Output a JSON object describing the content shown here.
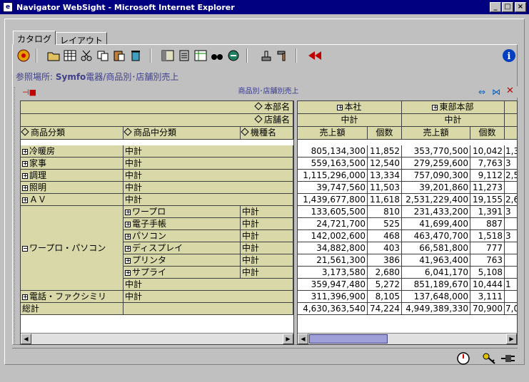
{
  "window": {
    "title": "Navigator WebSight - Microsoft Internet Explorer",
    "min": "_",
    "max": "□",
    "close": "×"
  },
  "tabs": [
    "カタログ",
    "レイアウト"
  ],
  "reference": {
    "label": "参照場所: ",
    "path_bold": "Symfo",
    "path_rest": "電器/商品別･店舗別売上"
  },
  "panel": {
    "title": "商品別･店舗別売上"
  },
  "left_headers": {
    "row1": "本部名",
    "row2": "店舗名",
    "col1": "商品分類",
    "col2": "商品中分類",
    "col3": "機種名"
  },
  "right_headers": {
    "hq1": "本社",
    "hq2": "東部本部",
    "sub1": "中計",
    "sub2": "中計",
    "m1": "売上額",
    "m2": "個数",
    "m3": "売上額",
    "m4": "個数"
  },
  "rows": [
    {
      "c1": "冷暖房",
      "c2": "中計",
      "c3": "",
      "v1": "805,134,300",
      "v2": "11,852",
      "v3": "353,770,500",
      "v4": "10,042",
      "v5": "1,3"
    },
    {
      "c1": "家事",
      "c2": "中計",
      "c3": "",
      "v1": "559,163,500",
      "v2": "12,540",
      "v3": "279,259,600",
      "v4": "7,763",
      "v5": "3"
    },
    {
      "c1": "調理",
      "c2": "中計",
      "c3": "",
      "v1": "1,115,296,000",
      "v2": "13,334",
      "v3": "757,090,300",
      "v4": "9,112",
      "v5": "2,5"
    },
    {
      "c1": "照明",
      "c2": "中計",
      "c3": "",
      "v1": "39,747,560",
      "v2": "11,503",
      "v3": "39,201,860",
      "v4": "11,273",
      "v5": ""
    },
    {
      "c1": "ＡＶ",
      "c2": "中計",
      "c3": "",
      "v1": "1,439,677,800",
      "v2": "11,618",
      "v3": "2,531,229,400",
      "v4": "19,155",
      "v5": "2,6"
    },
    {
      "c1": "",
      "c2": "ワープロ",
      "c3": "中計",
      "v1": "133,605,500",
      "v2": "810",
      "v3": "231,433,200",
      "v4": "1,391",
      "v5": "3"
    },
    {
      "c1": "",
      "c2": "電子手帳",
      "c3": "中計",
      "v1": "24,721,700",
      "v2": "525",
      "v3": "41,699,400",
      "v4": "887",
      "v5": ""
    },
    {
      "c1": "",
      "c2": "パソコン",
      "c3": "中計",
      "v1": "142,002,600",
      "v2": "468",
      "v3": "463,470,700",
      "v4": "1,518",
      "v5": "3"
    },
    {
      "c1": "ワープロ・パソコン",
      "c2": "ディスプレイ",
      "c3": "中計",
      "v1": "34,882,800",
      "v2": "403",
      "v3": "66,581,800",
      "v4": "777",
      "v5": ""
    },
    {
      "c1": "",
      "c2": "プリンタ",
      "c3": "中計",
      "v1": "21,561,300",
      "v2": "386",
      "v3": "41,963,400",
      "v4": "763",
      "v5": ""
    },
    {
      "c1": "",
      "c2": "サプライ",
      "c3": "中計",
      "v1": "3,173,580",
      "v2": "2,680",
      "v3": "6,041,170",
      "v4": "5,108",
      "v5": ""
    },
    {
      "c1": "",
      "c2": "中計",
      "c3": "",
      "v1": "359,947,480",
      "v2": "5,272",
      "v3": "851,189,670",
      "v4": "10,444",
      "v5": "1"
    },
    {
      "c1": "電話・ファクシミリ",
      "c2": "中計",
      "c3": "",
      "v1": "311,396,900",
      "v2": "8,105",
      "v3": "137,648,000",
      "v4": "3,111",
      "v5": ""
    },
    {
      "c1": "総計",
      "c2": "",
      "c3": "",
      "v1": "4,630,363,540",
      "v2": "74,224",
      "v3": "4,949,389,330",
      "v4": "70,900",
      "v5": "7,0"
    }
  ]
}
